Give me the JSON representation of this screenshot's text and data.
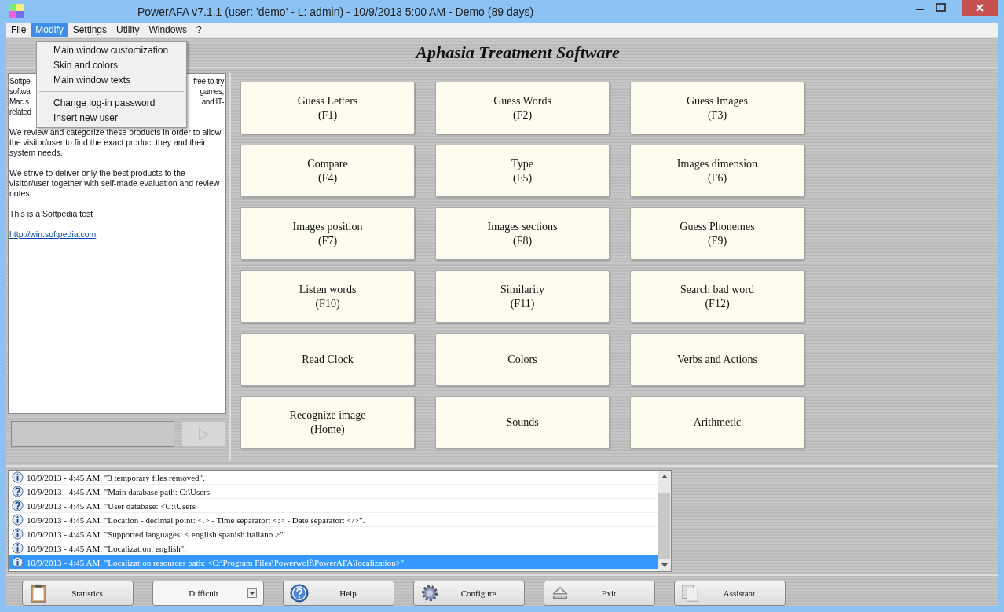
{
  "window": {
    "title": "PowerAFA v7.1.1  (user: 'demo'  - L: admin) - 10/9/2013 5:00 AM - Demo (89 days)"
  },
  "menu_bar": [
    {
      "label": "File",
      "selected": false
    },
    {
      "label": "Modify",
      "selected": true
    },
    {
      "label": "Settings",
      "selected": false
    },
    {
      "label": "Utility",
      "selected": false
    },
    {
      "label": "Windows",
      "selected": false
    },
    {
      "label": "?",
      "selected": false
    }
  ],
  "dropdown_menu": {
    "groups": [
      [
        "Main window customization",
        "Skin and colors",
        "Main window texts"
      ],
      [
        "Change log-in password",
        "Insert new user"
      ]
    ]
  },
  "header": {
    "title": "Aphasia Treatment Software"
  },
  "info_panel": {
    "covered_lines": [
      [
        "Softpe",
        "free-to-try"
      ],
      [
        "softwa",
        "games,"
      ],
      [
        "Mac s",
        "and IT-"
      ],
      [
        "related"
      ]
    ],
    "paragraphs": [
      "We review and categorize these products in order to allow the visitor/user to find the exact product they and their system needs.",
      "We strive to deliver only the best products to the visitor/user together with self-made evaluation and review notes.",
      "This is a Softpedia test"
    ],
    "link": "http://win.softpedia.com"
  },
  "exercises": [
    {
      "label": "Guess Letters",
      "key": "(F1)"
    },
    {
      "label": "Guess Words",
      "key": "(F2)"
    },
    {
      "label": "Guess Images",
      "key": "(F3)"
    },
    {
      "label": "Compare",
      "key": "(F4)"
    },
    {
      "label": "Type",
      "key": "(F5)"
    },
    {
      "label": "Images dimension",
      "key": "(F6)"
    },
    {
      "label": "Images position",
      "key": "(F7)"
    },
    {
      "label": "Images sections",
      "key": "(F8)"
    },
    {
      "label": "Guess Phonemes",
      "key": "(F9)"
    },
    {
      "label": "Listen words",
      "key": "(F10)"
    },
    {
      "label": "Similarity",
      "key": "(F11)"
    },
    {
      "label": "Search bad word",
      "key": "(F12)"
    },
    {
      "label": "Read Clock"
    },
    {
      "label": "Colors"
    },
    {
      "label": "Verbs and Actions"
    },
    {
      "label": "Recognize image",
      "key": "(Home)"
    },
    {
      "label": "Sounds"
    },
    {
      "label": "Arithmetic"
    }
  ],
  "log": [
    {
      "kind": "info",
      "text": "10/9/2013 - 4:45 AM. \"3 temporary files removed\".",
      "selected": false
    },
    {
      "kind": "question",
      "text": "10/9/2013 - 4:45 AM. \"Main database path: C:\\Users",
      "selected": false
    },
    {
      "kind": "question",
      "text": "10/9/2013 - 4:45 AM. \"User database: <C:\\Users",
      "selected": false
    },
    {
      "kind": "info",
      "text": "10/9/2013 - 4:45 AM. \"Location - decimal point: <.> - Time separator: <:> - Date separator: </>\".",
      "selected": false
    },
    {
      "kind": "info",
      "text": "10/9/2013 - 4:45 AM. \"Supported languages: < english spanish italiano >\".",
      "selected": false
    },
    {
      "kind": "info",
      "text": "10/9/2013 - 4:45 AM. \"Localization: english\".",
      "selected": false
    },
    {
      "kind": "info",
      "text": "10/9/2013 - 4:45 AM. \"Localization resources path: <C:\\Program Files\\Powerwolf\\PowerAFA\\localization>\".",
      "selected": true
    }
  ],
  "toolbar": [
    {
      "kind": "clipboard",
      "label": "Statistics"
    },
    {
      "kind": "dropdown",
      "label": "Difficult"
    },
    {
      "kind": "help",
      "label": "Help"
    },
    {
      "kind": "gear",
      "label": "Configure"
    },
    {
      "kind": "eject",
      "label": "Exit"
    },
    {
      "kind": "pages",
      "label": "Assistant"
    }
  ]
}
